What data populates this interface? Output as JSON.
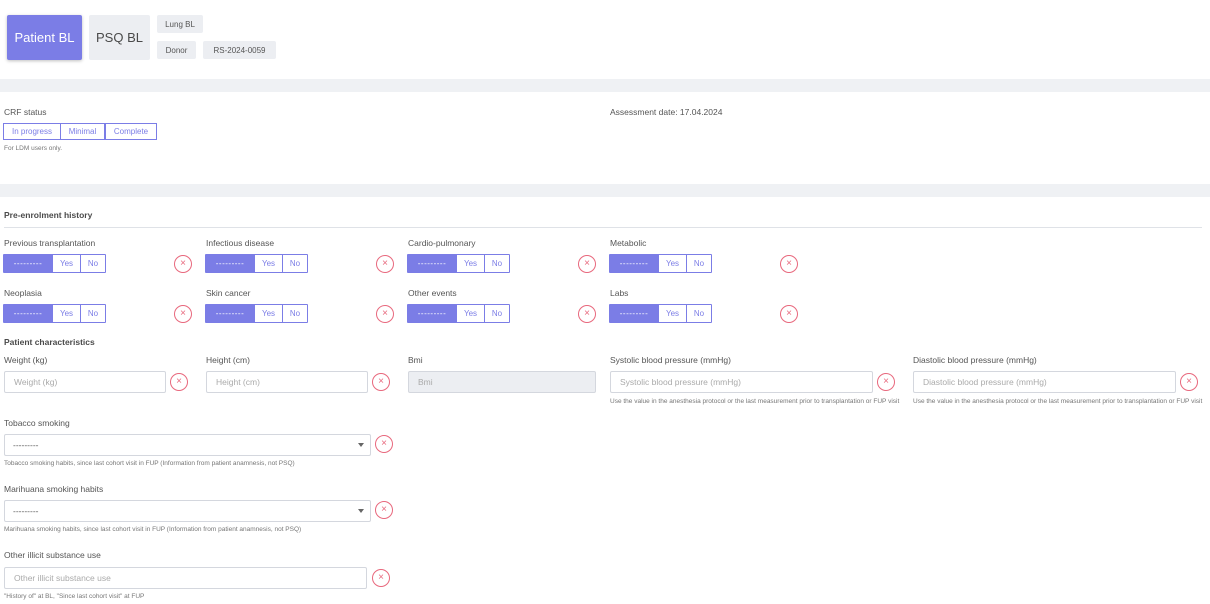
{
  "header": {
    "tabs": [
      {
        "label": "Patient BL",
        "active": true
      },
      {
        "label": "PSQ BL",
        "active": false
      }
    ],
    "chips": {
      "top": "Lung BL",
      "donor": "Donor",
      "id": "RS-2024-0059"
    }
  },
  "crf": {
    "label": "CRF status",
    "options": [
      "In progress",
      "Minimal",
      "Complete"
    ],
    "note": "For LDM users only.",
    "assessment_date": "Assessment date: 17.04.2024"
  },
  "pre_enrolment": {
    "title": "Pre-enrolment history",
    "choice": {
      "placeholder": "---------",
      "yes": "Yes",
      "no": "No"
    },
    "items": [
      {
        "label": "Previous transplantation"
      },
      {
        "label": "Infectious disease"
      },
      {
        "label": "Cardio-pulmonary"
      },
      {
        "label": "Metabolic"
      },
      {
        "label": "Neoplasia"
      },
      {
        "label": "Skin cancer"
      },
      {
        "label": "Other events"
      },
      {
        "label": "Labs"
      }
    ],
    "clear_glyph": "×"
  },
  "patient": {
    "title": "Patient characteristics",
    "weight": {
      "label": "Weight (kg)",
      "placeholder": "Weight (kg)"
    },
    "height": {
      "label": "Height (cm)",
      "placeholder": "Height (cm)"
    },
    "bmi": {
      "label": "Bmi",
      "placeholder": "Bmi"
    },
    "systolic": {
      "label": "Systolic blood pressure (mmHg)",
      "placeholder": "Systolic blood pressure (mmHg)",
      "hint": "Use the value in the anesthesia protocol or the last measurement prior to transplantation or FUP visit"
    },
    "diastolic": {
      "label": "Diastolic blood pressure (mmHg)",
      "placeholder": "Diastolic blood pressure (mmHg)",
      "hint": "Use the value in the anesthesia protocol or the last measurement prior to transplantation or FUP visit"
    },
    "tobacco": {
      "label": "Tobacco smoking",
      "value": "---------",
      "hint": "Tobacco smoking habits, since last cohort visit in FUP (Information from patient anamnesis, not PSQ)"
    },
    "marihuana": {
      "label": "Marihuana smoking habits",
      "value": "---------",
      "hint": "Marihuana smoking habits, since last cohort visit in FUP (Information from patient anamnesis, not PSQ)"
    },
    "illicit": {
      "label": "Other illicit substance use",
      "placeholder": "Other illicit substance use",
      "hint": "\"History of\" at BL, \"Since last cohort visit\" at FUP"
    }
  },
  "colors": {
    "accent": "#7b7de6",
    "danger": "#e8687d",
    "band": "#eff1f4"
  }
}
